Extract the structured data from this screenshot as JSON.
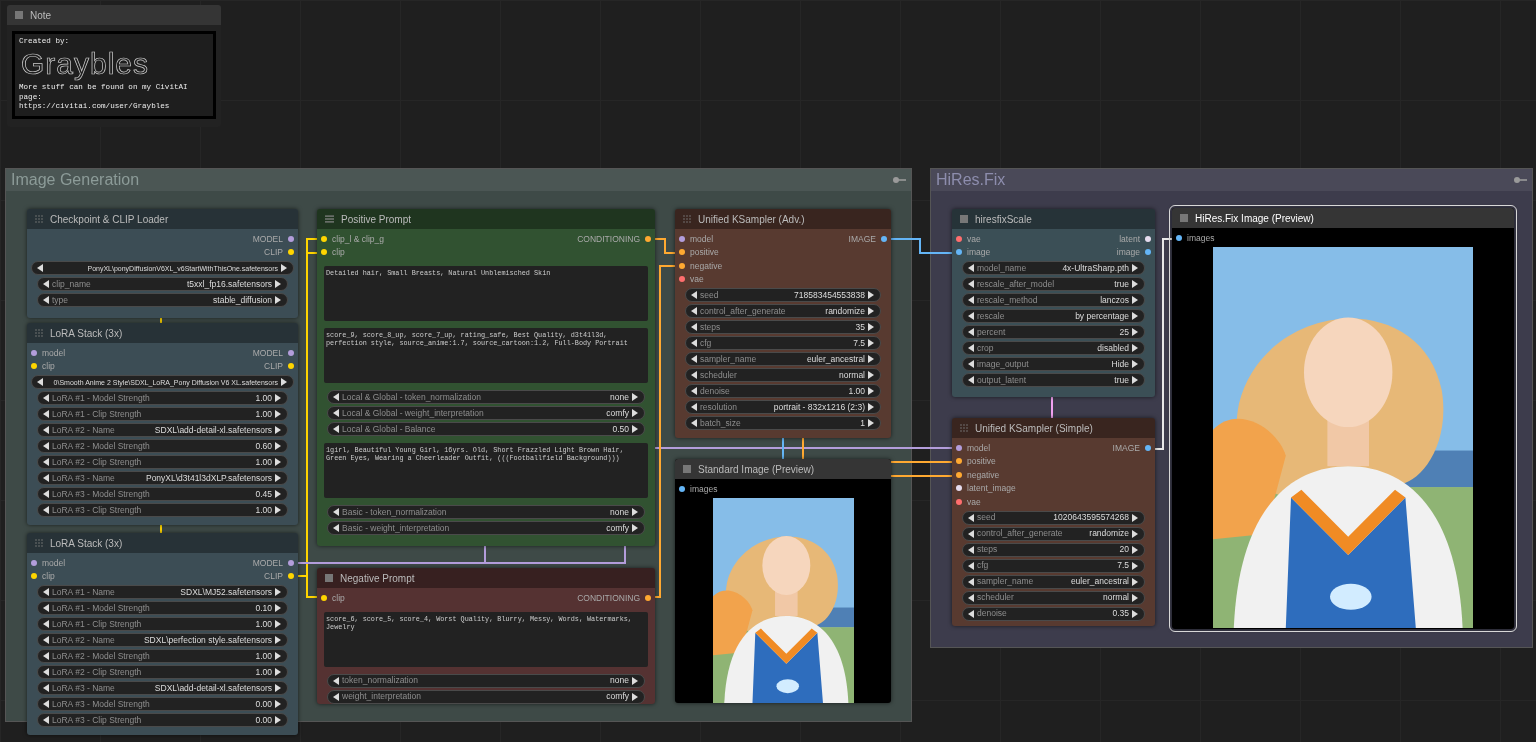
{
  "note": {
    "title": "Note",
    "created": "Created by:",
    "logo": "Graybles",
    "lines": [
      "More stuff can be found on my CivitAI page:",
      "https://civitai.com/user/Graybles"
    ]
  },
  "groups": [
    {
      "title": "Image Generation",
      "color": "#3e4a47"
    },
    {
      "title": "HiRes.Fix",
      "color": "#3d3c4c"
    }
  ],
  "nodes": [
    {
      "title": "Checkpoint & CLIP Loader",
      "color": "#3c4d55",
      "selected": false,
      "slots": [
        {
          "output": {
            "name": "MODEL",
            "color": "#b39ddb"
          }
        },
        {
          "output": {
            "name": "CLIP",
            "color": "#ffd500"
          }
        }
      ],
      "body": [
        {
          "kind": "widget",
          "value": "PonyXL\\ponyDiffusionV6XL_v6StartWithThisOne.safetensors"
        },
        {
          "kind": "widget",
          "label": "clip_name",
          "value": "t5xxl_fp16.safetensors"
        },
        {
          "kind": "widget",
          "label": "type",
          "value": "stable_diffusion"
        }
      ]
    },
    {
      "title": "LoRA Stack (3x)",
      "color": "#3c4d55",
      "selected": false,
      "slots": [
        {
          "input": {
            "name": "model",
            "color": "#b39ddb"
          },
          "output": {
            "name": "MODEL",
            "color": "#b39ddb"
          }
        },
        {
          "input": {
            "name": "clip",
            "color": "#ffd500"
          },
          "output": {
            "name": "CLIP",
            "color": "#ffd500"
          }
        }
      ],
      "body": [
        {
          "kind": "widget",
          "value": "0\\Smooth Anime 2 Style\\SDXL_LoRA_Pony Diffusion V6 XL.safetensors"
        },
        {
          "kind": "widget",
          "label": "LoRA #1 - Model Strength",
          "value": "1.00"
        },
        {
          "kind": "widget",
          "label": "LoRA #1 - Clip Strength",
          "value": "1.00"
        },
        {
          "kind": "widget",
          "label": "LoRA #2 - Name",
          "value": "SDXL\\add-detail-xl.safetensors"
        },
        {
          "kind": "widget",
          "label": "LoRA #2 - Model Strength",
          "value": "0.60"
        },
        {
          "kind": "widget",
          "label": "LoRA #2 - Clip Strength",
          "value": "1.00"
        },
        {
          "kind": "widget",
          "label": "LoRA #3 - Name",
          "value": "PonyXL\\d3t41l3dXLP.safetensors"
        },
        {
          "kind": "widget",
          "label": "LoRA #3 - Model Strength",
          "value": "0.45"
        },
        {
          "kind": "widget",
          "label": "LoRA #3 - Clip Strength",
          "value": "1.00"
        }
      ]
    },
    {
      "title": "LoRA Stack (3x)",
      "color": "#3c4d55",
      "selected": false,
      "slots": [
        {
          "input": {
            "name": "model",
            "color": "#b39ddb"
          },
          "output": {
            "name": "MODEL",
            "color": "#b39ddb"
          }
        },
        {
          "input": {
            "name": "clip",
            "color": "#ffd500"
          },
          "output": {
            "name": "CLIP",
            "color": "#ffd500"
          }
        }
      ],
      "body": [
        {
          "kind": "widget",
          "label": "LoRA #1 - Name",
          "value": "SDXL\\MJ52.safetensors"
        },
        {
          "kind": "widget",
          "label": "LoRA #1 - Model Strength",
          "value": "0.10"
        },
        {
          "kind": "widget",
          "label": "LoRA #1 - Clip Strength",
          "value": "1.00"
        },
        {
          "kind": "widget",
          "label": "LoRA #2 - Name",
          "value": "SDXL\\perfection style.safetensors"
        },
        {
          "kind": "widget",
          "label": "LoRA #2 - Model Strength",
          "value": "1.00"
        },
        {
          "kind": "widget",
          "label": "LoRA #2 - Clip Strength",
          "value": "1.00"
        },
        {
          "kind": "widget",
          "label": "LoRA #3 - Name",
          "value": "SDXL\\add-detail-xl.safetensors"
        },
        {
          "kind": "widget",
          "label": "LoRA #3 - Model Strength",
          "value": "0.00"
        },
        {
          "kind": "widget",
          "label": "LoRA #3 - Clip Strength",
          "value": "0.00"
        }
      ]
    },
    {
      "title": "Positive Prompt",
      "color": "#315231",
      "selected": false,
      "slots": [
        {
          "input": {
            "name": "clip_l & clip_g",
            "color": "#ffd500"
          },
          "output": {
            "name": "CONDITIONING",
            "color": "#ffa931"
          }
        },
        {
          "input": {
            "name": "clip",
            "color": "#ffd500"
          }
        }
      ],
      "body": [
        {
          "kind": "text",
          "value": "Detailed hair, Small Breasts, Natural Unblemisched Skin"
        },
        {
          "kind": "text",
          "value": "score_9, score_8_up, score_7_up, rating_safe, Best Quality, d3t41l3d, perfection style, source_anime:1.7, source_cartoon:1.2, Full-Body Portrait"
        },
        {
          "kind": "widget",
          "label": "Local & Global - token_normalization",
          "value": "none"
        },
        {
          "kind": "widget",
          "label": "Local & Global - weight_interpretation",
          "value": "comfy"
        },
        {
          "kind": "widget",
          "label": "Local & Global - Balance",
          "value": "0.50"
        },
        {
          "kind": "text",
          "value": "1girl, Beautiful Young Girl, 16yrs. Old, Short Frazzled Light Brown Hair, Green Eyes, Wearing a Cheerleader Outfit, (((Footballfield Background)))"
        },
        {
          "kind": "widget",
          "label": "Basic - token_normalization",
          "value": "none"
        },
        {
          "kind": "widget",
          "label": "Basic - weight_interpretation",
          "value": "comfy"
        }
      ]
    },
    {
      "title": "Negative Prompt",
      "color": "#553232",
      "selected": false,
      "slots": [
        {
          "input": {
            "name": "clip",
            "color": "#ffd500"
          },
          "output": {
            "name": "CONDITIONING",
            "color": "#ffa931"
          }
        }
      ],
      "body": [
        {
          "kind": "text",
          "value": "score_6, score_5, score_4, Worst Quality, Blurry, Messy, Words, Watermarks, Jewelry"
        },
        {
          "kind": "widget",
          "label": "token_normalization",
          "value": "none"
        },
        {
          "kind": "widget",
          "label": "weight_interpretation",
          "value": "comfy"
        }
      ]
    },
    {
      "title": "Unified KSampler (Adv.)",
      "color": "#583a30",
      "selected": false,
      "slots": [
        {
          "input": {
            "name": "model",
            "color": "#b39ddb"
          },
          "output": {
            "name": "IMAGE",
            "color": "#64b5f6"
          }
        },
        {
          "input": {
            "name": "positive",
            "color": "#ffa931"
          }
        },
        {
          "input": {
            "name": "negative",
            "color": "#ffa931"
          }
        },
        {
          "input": {
            "name": "vae",
            "color": "#ff6e6e"
          }
        }
      ],
      "body": [
        {
          "kind": "widget",
          "label": "seed",
          "value": "718583454553838"
        },
        {
          "kind": "widget",
          "label": "control_after_generate",
          "value": "randomize"
        },
        {
          "kind": "widget",
          "label": "steps",
          "value": "35"
        },
        {
          "kind": "widget",
          "label": "cfg",
          "value": "7.5"
        },
        {
          "kind": "widget",
          "label": "sampler_name",
          "value": "euler_ancestral"
        },
        {
          "kind": "widget",
          "label": "scheduler",
          "value": "normal"
        },
        {
          "kind": "widget",
          "label": "denoise",
          "value": "1.00"
        },
        {
          "kind": "widget",
          "label": "resolution",
          "value": "portrait - 832x1216 (2:3)"
        },
        {
          "kind": "widget",
          "label": "batch_size",
          "value": "1"
        }
      ]
    },
    {
      "title": "Standard Image (Preview)",
      "color": "#000000",
      "selected": false,
      "slots": [
        {
          "input": {
            "name": "images",
            "color": "#64b5f6"
          }
        }
      ],
      "body": [
        {
          "kind": "picture"
        }
      ]
    },
    {
      "title": "hiresfixScale",
      "color": "#3b4f56",
      "selected": false,
      "slots": [
        {
          "input": {
            "name": "vae",
            "color": "#ff6e6e"
          },
          "output": {
            "name": "latent",
            "color": "#e6dcef"
          }
        },
        {
          "input": {
            "name": "image",
            "color": "#64b5f6"
          },
          "output": {
            "name": "image",
            "color": "#64b5f6"
          }
        }
      ],
      "body": [
        {
          "kind": "widget",
          "label": "model_name",
          "value": "4x-UltraSharp.pth"
        },
        {
          "kind": "widget",
          "label": "rescale_after_model",
          "value": "true"
        },
        {
          "kind": "widget",
          "label": "rescale_method",
          "value": "lanczos"
        },
        {
          "kind": "widget",
          "label": "rescale",
          "value": "by percentage"
        },
        {
          "kind": "widget",
          "label": "percent",
          "value": "25"
        },
        {
          "kind": "widget",
          "label": "crop",
          "value": "disabled"
        },
        {
          "kind": "widget",
          "label": "image_output",
          "value": "Hide"
        },
        {
          "kind": "widget",
          "label": "output_latent",
          "value": "true"
        }
      ]
    },
    {
      "title": "Unified KSampler (Simple)",
      "color": "#583a30",
      "selected": false,
      "slots": [
        {
          "input": {
            "name": "model",
            "color": "#b39ddb"
          },
          "output": {
            "name": "IMAGE",
            "color": "#64b5f6"
          }
        },
        {
          "input": {
            "name": "positive",
            "color": "#ffa931"
          }
        },
        {
          "input": {
            "name": "negative",
            "color": "#ffa931"
          }
        },
        {
          "input": {
            "name": "latent_image",
            "color": "#e6dcef"
          }
        },
        {
          "input": {
            "name": "vae",
            "color": "#ff6e6e"
          }
        }
      ],
      "body": [
        {
          "kind": "widget",
          "label": "seed",
          "value": "1020643595574268"
        },
        {
          "kind": "widget",
          "label": "control_after_generate",
          "value": "randomize"
        },
        {
          "kind": "widget",
          "label": "steps",
          "value": "20"
        },
        {
          "kind": "widget",
          "label": "cfg",
          "value": "7.5"
        },
        {
          "kind": "widget",
          "label": "sampler_name",
          "value": "euler_ancestral"
        },
        {
          "kind": "widget",
          "label": "scheduler",
          "value": "normal"
        },
        {
          "kind": "widget",
          "label": "denoise",
          "value": "0.35"
        }
      ]
    },
    {
      "title": "HiRes.Fix Image (Preview)",
      "color": "#000000",
      "selected": true,
      "slots": [
        {
          "input": {
            "name": "images",
            "color": "#64b5f6"
          }
        }
      ],
      "body": [
        {
          "kind": "picture"
        }
      ]
    }
  ]
}
